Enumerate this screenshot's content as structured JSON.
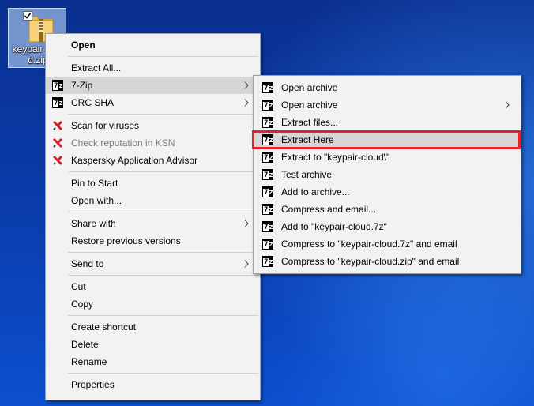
{
  "desktop": {
    "icon_label": "keypair-cloud.zip",
    "icon_label_visible": "keypair-clou\nd.zip"
  },
  "main_menu": {
    "open": "Open",
    "extract_all": "Extract All...",
    "seven_zip": "7-Zip",
    "crc_sha": "CRC SHA",
    "scan_viruses": "Scan for viruses",
    "check_reputation": "Check reputation in KSN",
    "kaspersky_advisor": "Kaspersky Application Advisor",
    "pin_to_start": "Pin to Start",
    "open_with": "Open with...",
    "share_with": "Share with",
    "restore_versions": "Restore previous versions",
    "send_to": "Send to",
    "cut": "Cut",
    "copy": "Copy",
    "create_shortcut": "Create shortcut",
    "delete": "Delete",
    "rename": "Rename",
    "properties": "Properties"
  },
  "sub_menu": {
    "open_archive": "Open archive",
    "open_archive_2": "Open archive",
    "extract_files": "Extract files...",
    "extract_here": "Extract Here",
    "extract_to": "Extract to \"keypair-cloud\\\"",
    "test_archive": "Test archive",
    "add_to_archive": "Add to archive...",
    "compress_email": "Compress and email...",
    "add_to_7z": "Add to \"keypair-cloud.7z\"",
    "compress_7z_email": "Compress to \"keypair-cloud.7z\" and email",
    "compress_zip_email": "Compress to \"keypair-cloud.zip\" and email"
  },
  "icons": {
    "seven_zip": "7z-icon",
    "kaspersky": "kaspersky-icon",
    "submenu_arrow": "chevron-right-icon"
  },
  "colors": {
    "highlight_box": "#e81f2a",
    "menu_bg": "#f2f2f2",
    "hover_bg": "#d6d6d6"
  }
}
